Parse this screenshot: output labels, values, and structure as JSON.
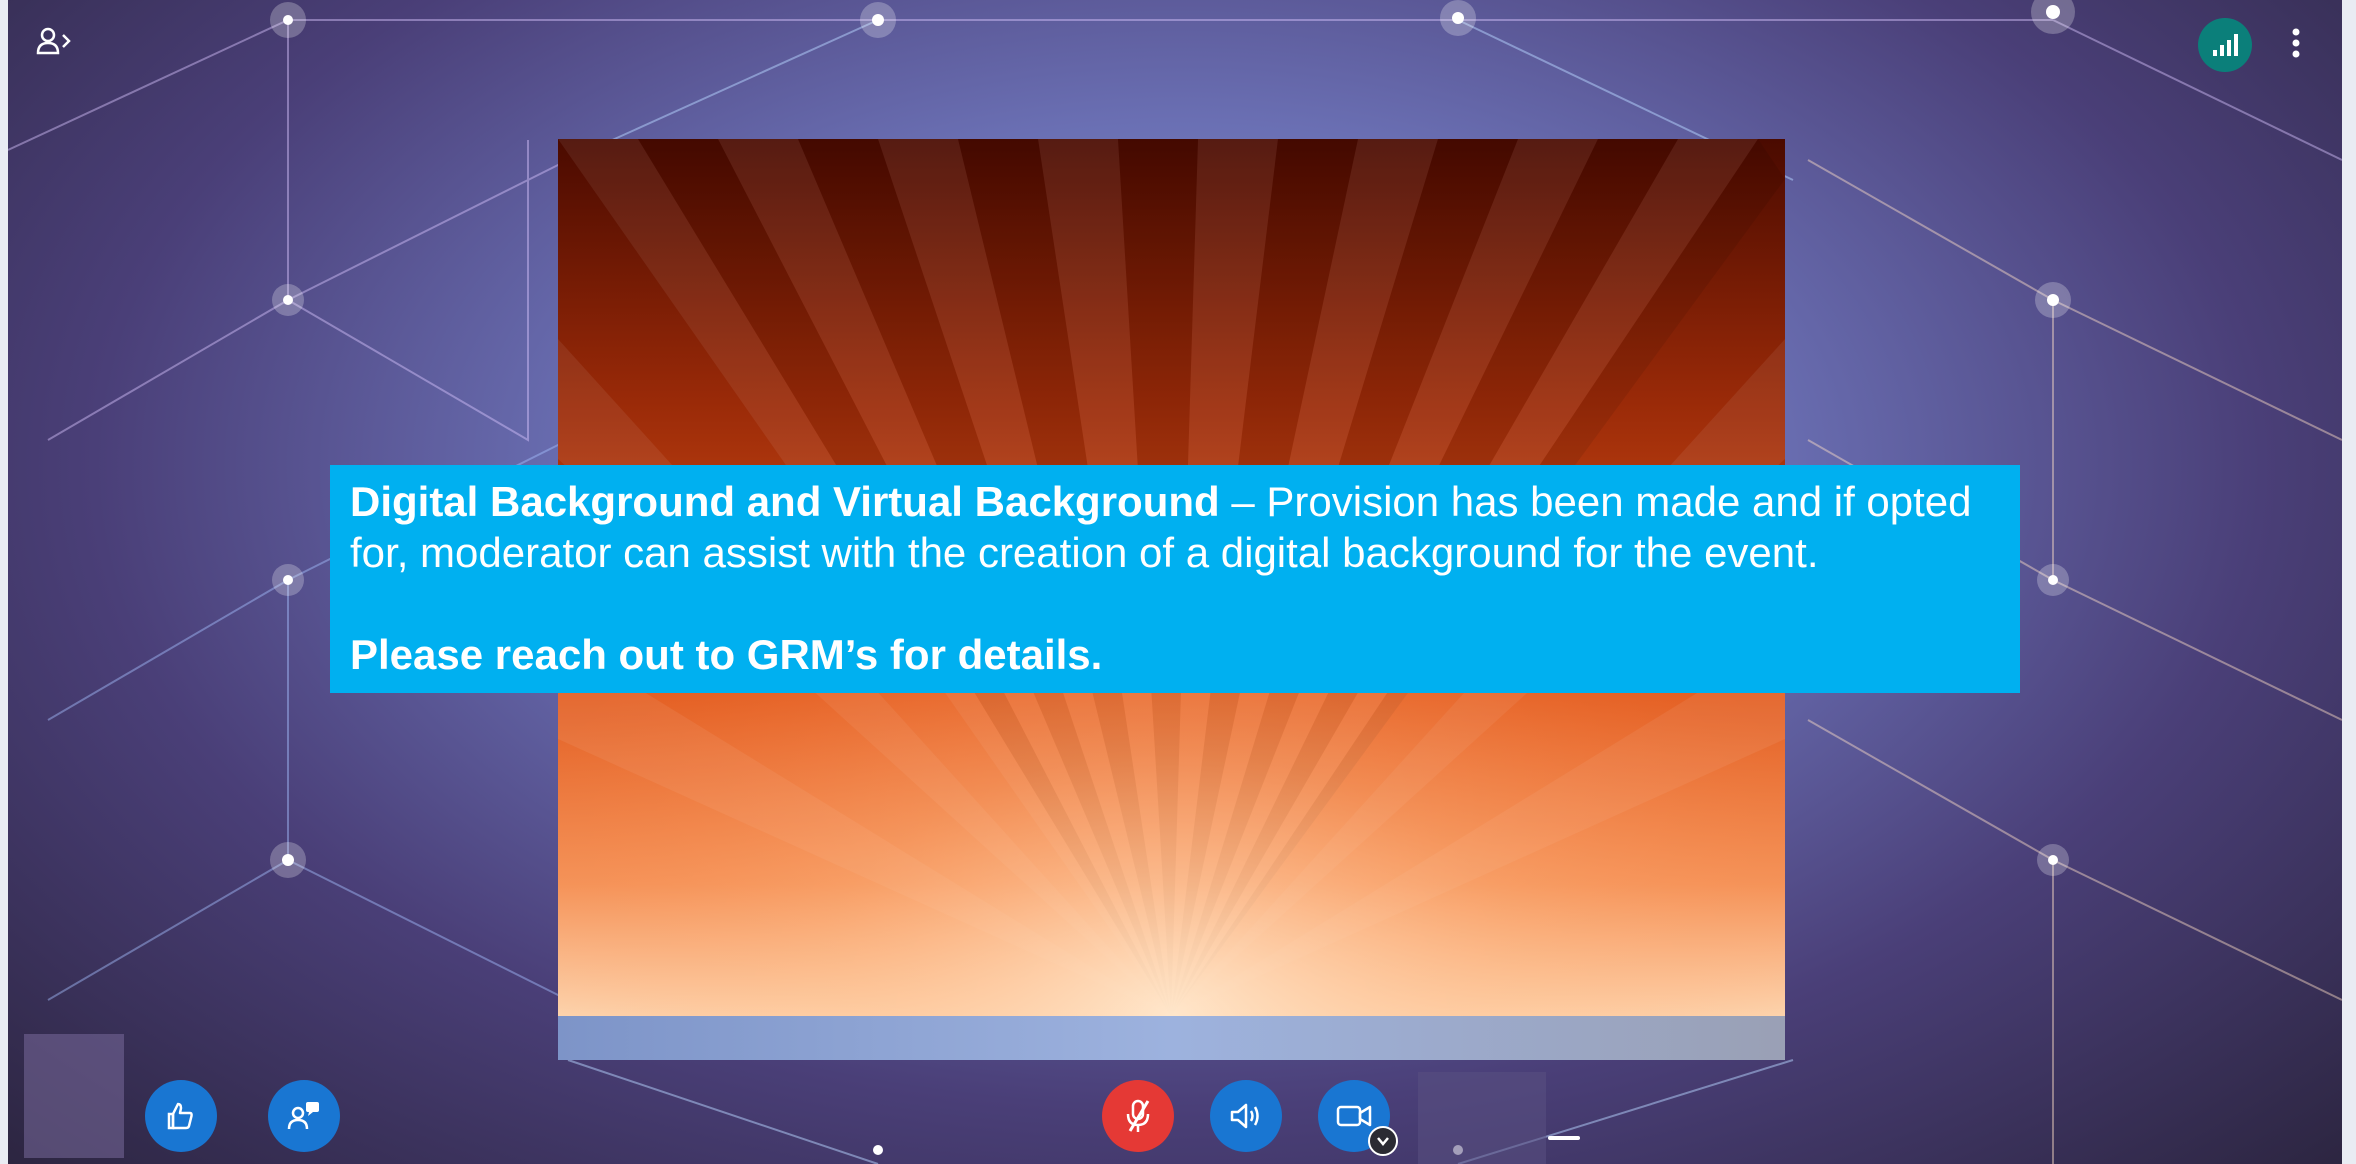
{
  "topbar": {
    "participants_icon": "participants-icon",
    "signal_icon": "signal-strength-icon",
    "more_icon": "more-vertical-icon"
  },
  "slide": {
    "caption": {
      "heading": "Digital Background and Virtual Background",
      "body": " – Provision has been made and if opted for, moderator can assist with the creation of a digital background for the event.",
      "note": "Please reach out to GRM’s for details."
    }
  },
  "controls": {
    "like_icon": "thumbs-up-icon",
    "moderator_icon": "moderator-icon",
    "mic_icon": "mic-muted-icon",
    "speaker_icon": "speaker-icon",
    "camera_icon": "camera-icon",
    "camera_options_icon": "chevron-down-icon"
  },
  "colors": {
    "caption_bg": "#00b0f0",
    "control_blue": "#1976d2",
    "mic_muted_red": "#e53935",
    "signal_teal": "#0b7f7a"
  }
}
